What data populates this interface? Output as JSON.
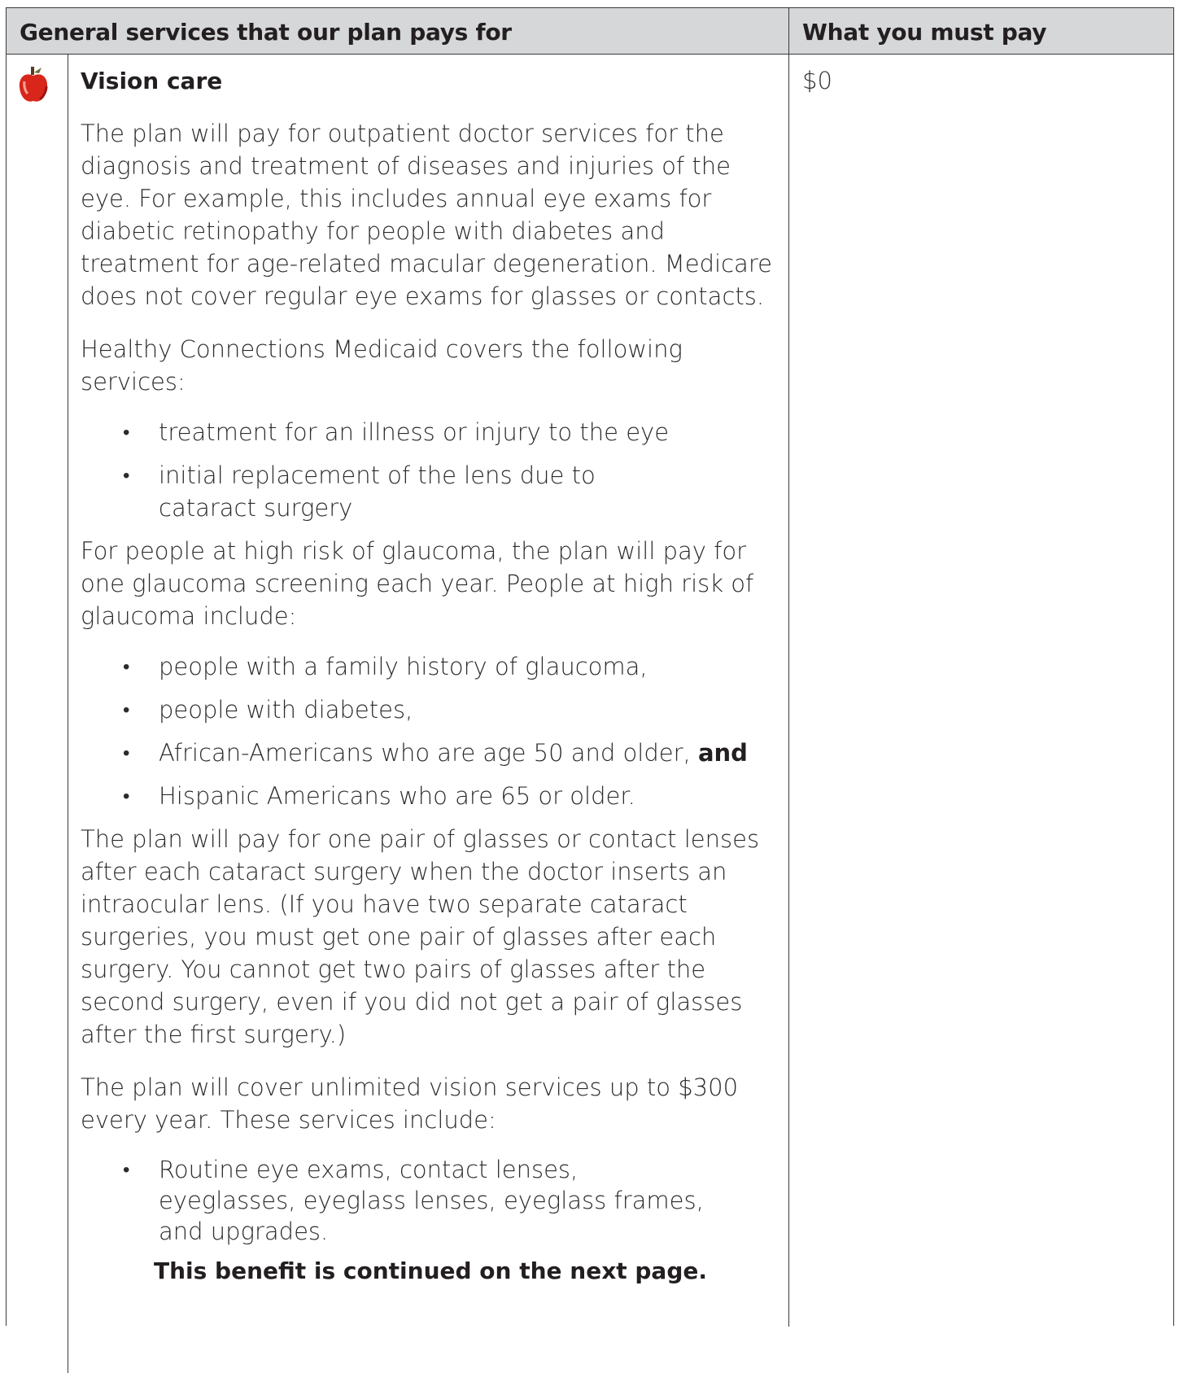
{
  "header": {
    "left": "General services that our plan pays for",
    "right": "What you must pay"
  },
  "icon": "apple-icon",
  "section": {
    "title": "Vision care",
    "cost": "$0",
    "p1": "The plan will pay for outpatient doctor services for the diagnosis and treatment of diseases and injuries of the eye. For example, this includes annual eye exams for diabetic retinopathy for people with diabetes and treatment for age-related macular degeneration. Medicare does not cover regular eye exams for glasses or contacts.",
    "p2": "Healthy Connections Medicaid covers the following services:",
    "list1": [
      "treatment for an illness or injury to the eye",
      "initial replacement of the lens due to cataract surgery"
    ],
    "p3": "For people at high risk of glaucoma, the plan will pay for one glaucoma screening each year. People at high risk of glaucoma include:",
    "list2": [
      "people with a family history of glaucoma,",
      "people with diabetes,",
      "African-Americans who are age 50 and older,",
      "Hispanic Americans who are 65 or older."
    ],
    "list2_bold": "and",
    "p4": "The plan will pay for one pair of glasses or contact lenses after each cataract surgery when the doctor inserts an intraocular lens. (If you have two separate cataract surgeries, you must get one pair of glasses after each surgery. You cannot get two pairs of glasses after the second surgery, even if you did not get a pair of glasses after the first surgery.)",
    "p5": "The plan will cover unlimited vision services up to $300 every year.  These services include:",
    "list3": [
      "Routine eye exams, contact lenses, eyeglasses, eyeglass lenses, eyeglass frames, and upgrades."
    ],
    "continued": "This benefit is continued on the next page."
  }
}
